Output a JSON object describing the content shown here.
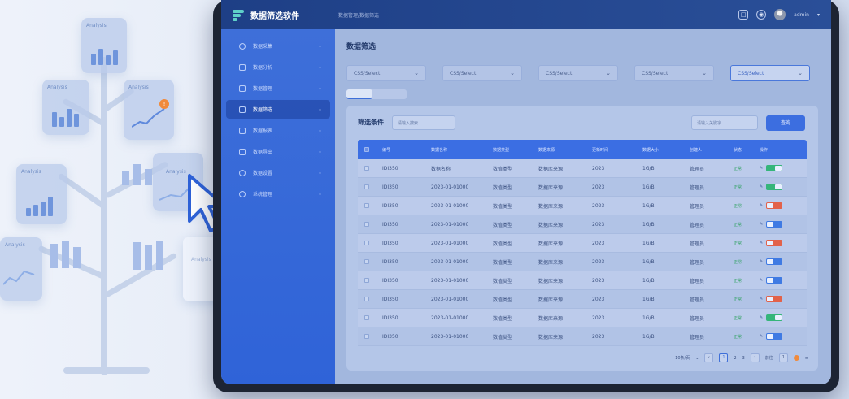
{
  "app": {
    "title": "数据筛选软件",
    "breadcrumb": "数据管理/数据筛选"
  },
  "topbar": {
    "user": "admin"
  },
  "sidebar": {
    "items": [
      {
        "label": "数据采集",
        "icon": "clock-icon"
      },
      {
        "label": "数据分析",
        "icon": "list-icon"
      },
      {
        "label": "数据管理",
        "icon": "monitor-icon"
      },
      {
        "label": "数据筛选",
        "icon": "filter-icon",
        "active": true
      },
      {
        "label": "数据报表",
        "icon": "chart-icon"
      },
      {
        "label": "数据导出",
        "icon": "export-icon"
      },
      {
        "label": "数据设置",
        "icon": "gear-icon"
      },
      {
        "label": "系统管理",
        "icon": "user-icon"
      }
    ]
  },
  "main": {
    "title": "数据筛选",
    "filters": [
      {
        "value": "CSS/Select"
      },
      {
        "value": "CSS/Select"
      },
      {
        "value": "CSS/Select"
      },
      {
        "value": "CSS/Select"
      },
      {
        "value": "CSS/Select",
        "highlight": true
      }
    ],
    "panel": {
      "filter_label": "筛选条件",
      "search_placeholder": "请输入搜索",
      "search2_placeholder": "请输入关键字",
      "search_button": "查询"
    },
    "table": {
      "headers": [
        "",
        "编号",
        "数据名称",
        "数据类型",
        "数据来源",
        "更新时间",
        "数据大小",
        "创建人",
        "状态",
        "操作"
      ],
      "rows": [
        {
          "id": "IDI350",
          "name": "数据名称",
          "type": "数值类型",
          "source": "数据库来源",
          "time": "2023",
          "size": "1G/B",
          "creator": "管理员",
          "status": "正常",
          "pill": "green"
        },
        {
          "id": "IDI350",
          "name": "2023-01-01000",
          "type": "数值类型",
          "source": "数据库来源",
          "time": "2023",
          "size": "1G/B",
          "creator": "管理员",
          "status": "正常",
          "pill": "green"
        },
        {
          "id": "IDI350",
          "name": "2023-01-01000",
          "type": "数值类型",
          "source": "数据库来源",
          "time": "2023",
          "size": "1G/B",
          "creator": "管理员",
          "status": "正常",
          "pill": "red"
        },
        {
          "id": "IDI350",
          "name": "2023-01-01000",
          "type": "数值类型",
          "source": "数据库来源",
          "time": "2023",
          "size": "1G/B",
          "creator": "管理员",
          "status": "正常",
          "pill": "blue"
        },
        {
          "id": "IDI350",
          "name": "2023-01-01000",
          "type": "数值类型",
          "source": "数据库来源",
          "time": "2023",
          "size": "1G/B",
          "creator": "管理员",
          "status": "正常",
          "pill": "red"
        },
        {
          "id": "IDI350",
          "name": "2023-01-01000",
          "type": "数值类型",
          "source": "数据库来源",
          "time": "2023",
          "size": "1G/B",
          "creator": "管理员",
          "status": "正常",
          "pill": "blue"
        },
        {
          "id": "IDI350",
          "name": "2023-01-01000",
          "type": "数值类型",
          "source": "数据库来源",
          "time": "2023",
          "size": "1G/B",
          "creator": "管理员",
          "status": "正常",
          "pill": "blue"
        },
        {
          "id": "IDI350",
          "name": "2023-01-01000",
          "type": "数值类型",
          "source": "数据库来源",
          "time": "2023",
          "size": "1G/B",
          "creator": "管理员",
          "status": "正常",
          "pill": "red"
        },
        {
          "id": "IDI350",
          "name": "2023-01-01000",
          "type": "数值类型",
          "source": "数据库来源",
          "time": "2023",
          "size": "1G/B",
          "creator": "管理员",
          "status": "正常",
          "pill": "green"
        },
        {
          "id": "IDI350",
          "name": "2023-01-01000",
          "type": "数值类型",
          "source": "数据库来源",
          "time": "2023",
          "size": "1G/B",
          "creator": "管理员",
          "status": "正常",
          "pill": "blue"
        }
      ]
    },
    "pager": {
      "page_size": "10条/页",
      "current": "1",
      "pages": [
        "1",
        "2",
        "3"
      ],
      "goto": "前往"
    }
  },
  "illustration": {
    "card_labels": [
      "Analysis",
      "Analysis",
      "Analysis",
      "Analysis",
      "Analysis",
      "Analysis"
    ]
  },
  "colors": {
    "accent": "#3b6ee3",
    "sidebar": "#2f63d8",
    "topbar": "#1e3f86",
    "success": "#35b57a",
    "danger": "#e2624a"
  }
}
